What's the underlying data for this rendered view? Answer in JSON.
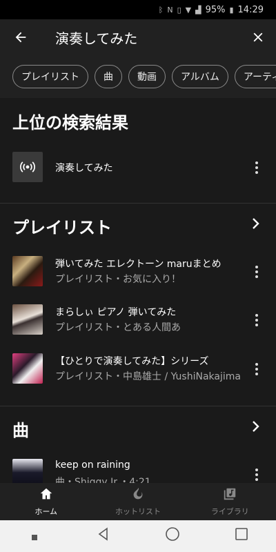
{
  "status_bar": {
    "battery": "95%",
    "time": "14:29"
  },
  "search": {
    "query": "演奏してみた"
  },
  "chips": [
    "プレイリスト",
    "曲",
    "動画",
    "アルバム",
    "アーティ"
  ],
  "top_result": {
    "section_title": "上位の検索結果",
    "title": "演奏してみた"
  },
  "playlists": {
    "section_title": "プレイリスト",
    "items": [
      {
        "title": "弾いてみた エレクトーン maruまとめ",
        "subtitle": "プレイリスト・お気に入り！"
      },
      {
        "title": "まらしぃ ピアノ 弾いてみた",
        "subtitle": "プレイリスト・とある人間あ"
      },
      {
        "title": "【ひとりで演奏してみた】シリーズ",
        "subtitle": "プレイリスト・中島雄士 / YushiNakajima"
      }
    ]
  },
  "songs": {
    "section_title": "曲",
    "items": [
      {
        "title": "keep on raining",
        "subtitle": "曲・Shiggy Jr.・4:21"
      }
    ]
  },
  "bottom_nav": [
    {
      "label": "ホーム",
      "icon": "home-icon",
      "active": true
    },
    {
      "label": "ホットリスト",
      "icon": "fire-icon",
      "active": false
    },
    {
      "label": "ライブラリ",
      "icon": "library-icon",
      "active": false
    }
  ]
}
